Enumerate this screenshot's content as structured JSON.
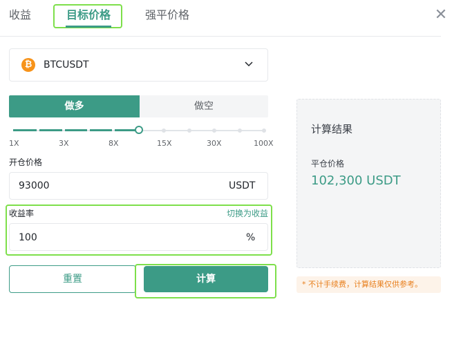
{
  "tabs": [
    {
      "label": "收益"
    },
    {
      "label": "目标价格"
    },
    {
      "label": "强平价格"
    }
  ],
  "close_icon": "close-icon",
  "symbol": {
    "name": "BTCUSDT",
    "coin_glyph": "₿"
  },
  "side": {
    "long_label": "做多",
    "short_label": "做空",
    "selected": "long"
  },
  "leverage": {
    "labels": [
      "1X",
      "3X",
      "8X",
      "15X",
      "30X",
      "100X"
    ],
    "selected_index": 3
  },
  "open_price": {
    "label": "开仓价格",
    "value": "93000",
    "unit": "USDT"
  },
  "rate": {
    "label": "收益率",
    "switch_label": "切换为收益",
    "value": "100",
    "unit": "%"
  },
  "buttons": {
    "reset": "重置",
    "calculate": "计算"
  },
  "result": {
    "title": "计算结果",
    "label": "平仓价格",
    "value": "102,300 USDT",
    "note": "* 不计手续费，计算结果仅供参考。"
  },
  "colors": {
    "accent": "#3c9b86",
    "highlight": "#7ddf4a",
    "warning": "#e8801f"
  }
}
